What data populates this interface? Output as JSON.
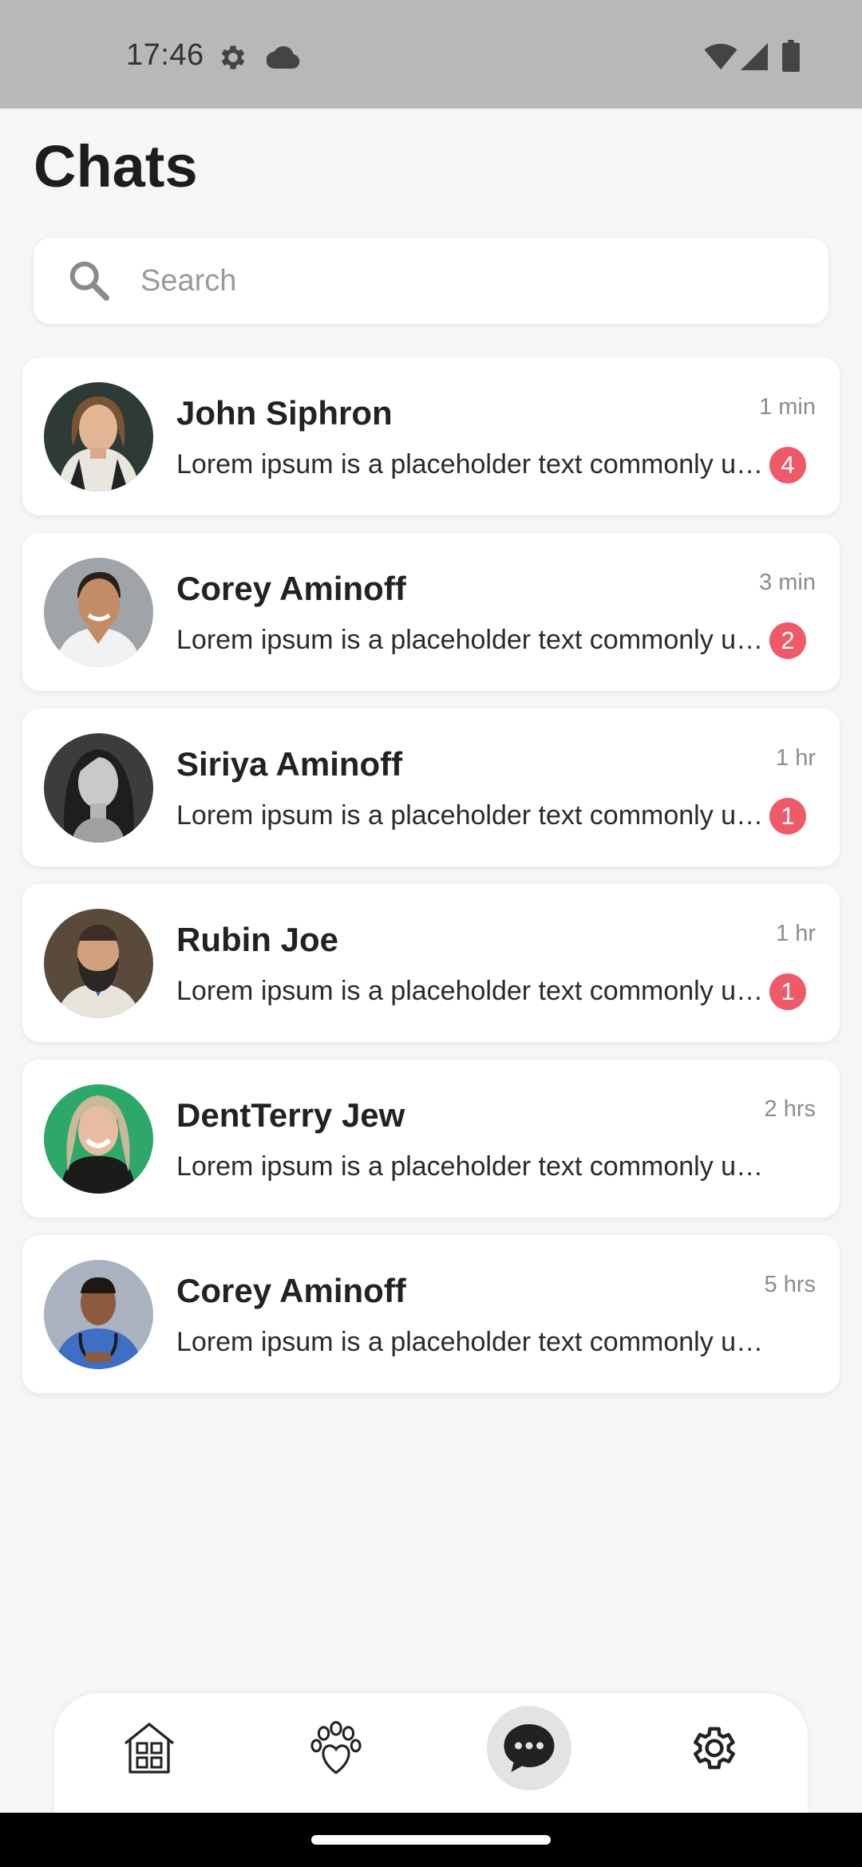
{
  "status_bar": {
    "time": "17:46",
    "icons": [
      "settings-icon",
      "cloud-icon",
      "wifi-icon",
      "signal-icon",
      "battery-icon"
    ]
  },
  "header": {
    "title": "Chats"
  },
  "search": {
    "placeholder": "Search",
    "value": "",
    "icon": "search-icon"
  },
  "chats": [
    {
      "name": "John Siphron",
      "time": "1 min",
      "message": "Lorem ipsum is a placeholder text commonly used to demonstrate",
      "unread": "4"
    },
    {
      "name": "Corey Aminoff",
      "time": "3 min",
      "message": "Lorem ipsum is a placeholder text commonly used to demonstrate",
      "unread": "2"
    },
    {
      "name": "Siriya Aminoff",
      "time": "1 hr",
      "message": "Lorem ipsum is a placeholder text commonly used to demonstrate",
      "unread": "1"
    },
    {
      "name": "Rubin Joe",
      "time": "1 hr",
      "message": "Lorem ipsum is a placeholder text commonly used to demonstrate",
      "unread": "1"
    },
    {
      "name": "DentTerry Jew",
      "time": "2 hrs",
      "message": "Lorem ipsum is a placeholder text commonly used to demonstrate",
      "unread": null
    },
    {
      "name": "Corey Aminoff",
      "time": "5 hrs",
      "message": "Lorem ipsum is a placeholder text commonly used to demonstrate",
      "unread": null
    }
  ],
  "bottom_nav": {
    "items": [
      {
        "icon": "home-icon",
        "active": false
      },
      {
        "icon": "paw-heart-icon",
        "active": false
      },
      {
        "icon": "chat-bubble-icon",
        "active": true
      },
      {
        "icon": "settings-icon",
        "active": false
      }
    ]
  },
  "colors": {
    "background": "#f6f6f6",
    "card": "#ffffff",
    "badge": "#ef5a6a",
    "status_bar": "#b8b8b8",
    "nav_active": "#e3e3e3"
  }
}
